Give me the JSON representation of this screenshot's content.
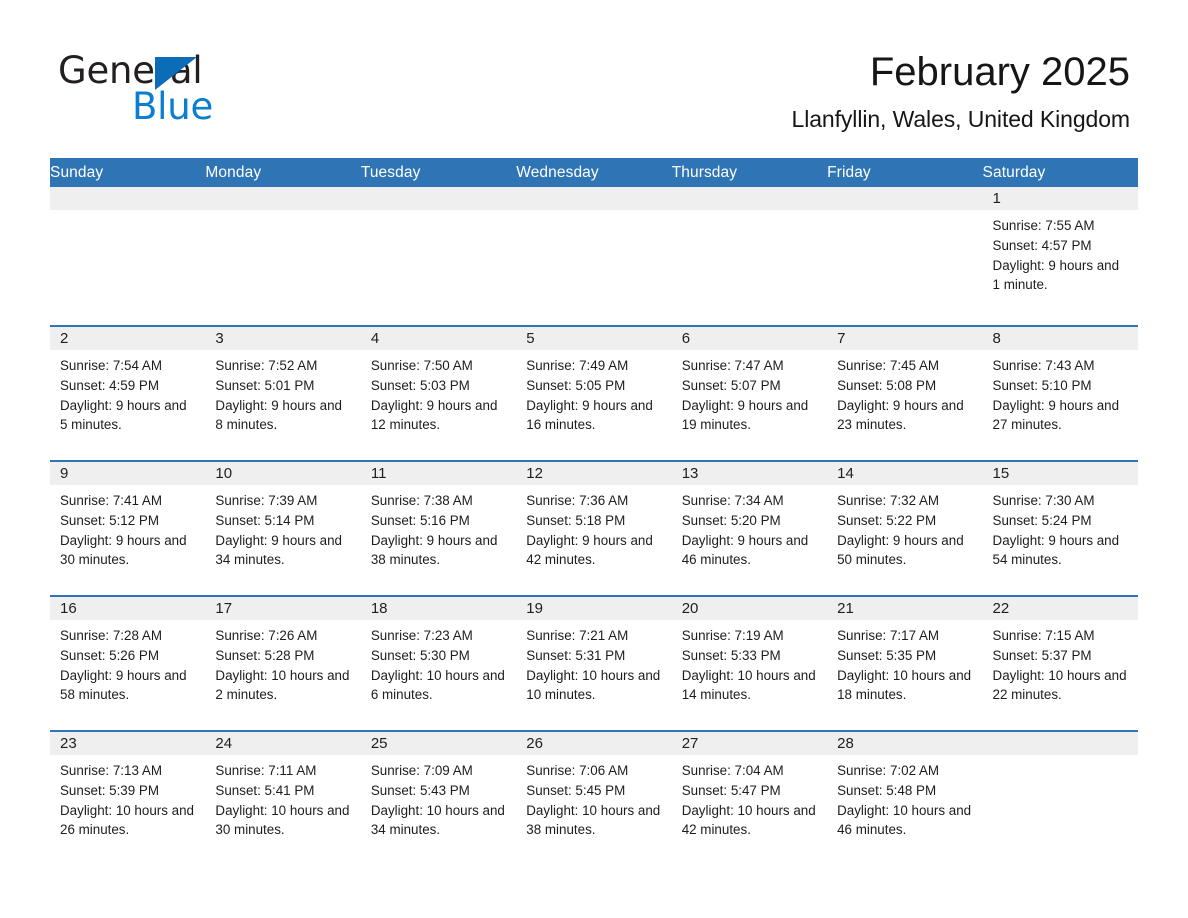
{
  "brand": {
    "name_part1": "General",
    "name_part2": "Blue",
    "accent_color": "#0b7ed0",
    "triangle_color": "#0b6cb7"
  },
  "header": {
    "title": "February 2025",
    "subtitle": "Llanfyllin, Wales, United Kingdom",
    "header_bg": "#2f74b5",
    "daynum_bg": "#efefef"
  },
  "weekday_headers": [
    "Sunday",
    "Monday",
    "Tuesday",
    "Wednesday",
    "Thursday",
    "Friday",
    "Saturday"
  ],
  "labels": {
    "sunrise_prefix": "Sunrise:",
    "sunset_prefix": "Sunset:",
    "daylight_prefix": "Daylight:"
  },
  "weeks": [
    [
      {
        "day": "",
        "empty": true
      },
      {
        "day": "",
        "empty": true
      },
      {
        "day": "",
        "empty": true
      },
      {
        "day": "",
        "empty": true
      },
      {
        "day": "",
        "empty": true
      },
      {
        "day": "",
        "empty": true
      },
      {
        "day": "1",
        "sunrise": "Sunrise: 7:55 AM",
        "sunset": "Sunset: 4:57 PM",
        "daylight": "Daylight: 9 hours and 1 minute."
      }
    ],
    [
      {
        "day": "2",
        "sunrise": "Sunrise: 7:54 AM",
        "sunset": "Sunset: 4:59 PM",
        "daylight": "Daylight: 9 hours and 5 minutes."
      },
      {
        "day": "3",
        "sunrise": "Sunrise: 7:52 AM",
        "sunset": "Sunset: 5:01 PM",
        "daylight": "Daylight: 9 hours and 8 minutes."
      },
      {
        "day": "4",
        "sunrise": "Sunrise: 7:50 AM",
        "sunset": "Sunset: 5:03 PM",
        "daylight": "Daylight: 9 hours and 12 minutes."
      },
      {
        "day": "5",
        "sunrise": "Sunrise: 7:49 AM",
        "sunset": "Sunset: 5:05 PM",
        "daylight": "Daylight: 9 hours and 16 minutes."
      },
      {
        "day": "6",
        "sunrise": "Sunrise: 7:47 AM",
        "sunset": "Sunset: 5:07 PM",
        "daylight": "Daylight: 9 hours and 19 minutes."
      },
      {
        "day": "7",
        "sunrise": "Sunrise: 7:45 AM",
        "sunset": "Sunset: 5:08 PM",
        "daylight": "Daylight: 9 hours and 23 minutes."
      },
      {
        "day": "8",
        "sunrise": "Sunrise: 7:43 AM",
        "sunset": "Sunset: 5:10 PM",
        "daylight": "Daylight: 9 hours and 27 minutes."
      }
    ],
    [
      {
        "day": "9",
        "sunrise": "Sunrise: 7:41 AM",
        "sunset": "Sunset: 5:12 PM",
        "daylight": "Daylight: 9 hours and 30 minutes."
      },
      {
        "day": "10",
        "sunrise": "Sunrise: 7:39 AM",
        "sunset": "Sunset: 5:14 PM",
        "daylight": "Daylight: 9 hours and 34 minutes."
      },
      {
        "day": "11",
        "sunrise": "Sunrise: 7:38 AM",
        "sunset": "Sunset: 5:16 PM",
        "daylight": "Daylight: 9 hours and 38 minutes."
      },
      {
        "day": "12",
        "sunrise": "Sunrise: 7:36 AM",
        "sunset": "Sunset: 5:18 PM",
        "daylight": "Daylight: 9 hours and 42 minutes."
      },
      {
        "day": "13",
        "sunrise": "Sunrise: 7:34 AM",
        "sunset": "Sunset: 5:20 PM",
        "daylight": "Daylight: 9 hours and 46 minutes."
      },
      {
        "day": "14",
        "sunrise": "Sunrise: 7:32 AM",
        "sunset": "Sunset: 5:22 PM",
        "daylight": "Daylight: 9 hours and 50 minutes."
      },
      {
        "day": "15",
        "sunrise": "Sunrise: 7:30 AM",
        "sunset": "Sunset: 5:24 PM",
        "daylight": "Daylight: 9 hours and 54 minutes."
      }
    ],
    [
      {
        "day": "16",
        "sunrise": "Sunrise: 7:28 AM",
        "sunset": "Sunset: 5:26 PM",
        "daylight": "Daylight: 9 hours and 58 minutes."
      },
      {
        "day": "17",
        "sunrise": "Sunrise: 7:26 AM",
        "sunset": "Sunset: 5:28 PM",
        "daylight": "Daylight: 10 hours and 2 minutes."
      },
      {
        "day": "18",
        "sunrise": "Sunrise: 7:23 AM",
        "sunset": "Sunset: 5:30 PM",
        "daylight": "Daylight: 10 hours and 6 minutes."
      },
      {
        "day": "19",
        "sunrise": "Sunrise: 7:21 AM",
        "sunset": "Sunset: 5:31 PM",
        "daylight": "Daylight: 10 hours and 10 minutes."
      },
      {
        "day": "20",
        "sunrise": "Sunrise: 7:19 AM",
        "sunset": "Sunset: 5:33 PM",
        "daylight": "Daylight: 10 hours and 14 minutes."
      },
      {
        "day": "21",
        "sunrise": "Sunrise: 7:17 AM",
        "sunset": "Sunset: 5:35 PM",
        "daylight": "Daylight: 10 hours and 18 minutes."
      },
      {
        "day": "22",
        "sunrise": "Sunrise: 7:15 AM",
        "sunset": "Sunset: 5:37 PM",
        "daylight": "Daylight: 10 hours and 22 minutes."
      }
    ],
    [
      {
        "day": "23",
        "sunrise": "Sunrise: 7:13 AM",
        "sunset": "Sunset: 5:39 PM",
        "daylight": "Daylight: 10 hours and 26 minutes."
      },
      {
        "day": "24",
        "sunrise": "Sunrise: 7:11 AM",
        "sunset": "Sunset: 5:41 PM",
        "daylight": "Daylight: 10 hours and 30 minutes."
      },
      {
        "day": "25",
        "sunrise": "Sunrise: 7:09 AM",
        "sunset": "Sunset: 5:43 PM",
        "daylight": "Daylight: 10 hours and 34 minutes."
      },
      {
        "day": "26",
        "sunrise": "Sunrise: 7:06 AM",
        "sunset": "Sunset: 5:45 PM",
        "daylight": "Daylight: 10 hours and 38 minutes."
      },
      {
        "day": "27",
        "sunrise": "Sunrise: 7:04 AM",
        "sunset": "Sunset: 5:47 PM",
        "daylight": "Daylight: 10 hours and 42 minutes."
      },
      {
        "day": "28",
        "sunrise": "Sunrise: 7:02 AM",
        "sunset": "Sunset: 5:48 PM",
        "daylight": "Daylight: 10 hours and 46 minutes."
      },
      {
        "day": "",
        "empty": true
      }
    ]
  ]
}
